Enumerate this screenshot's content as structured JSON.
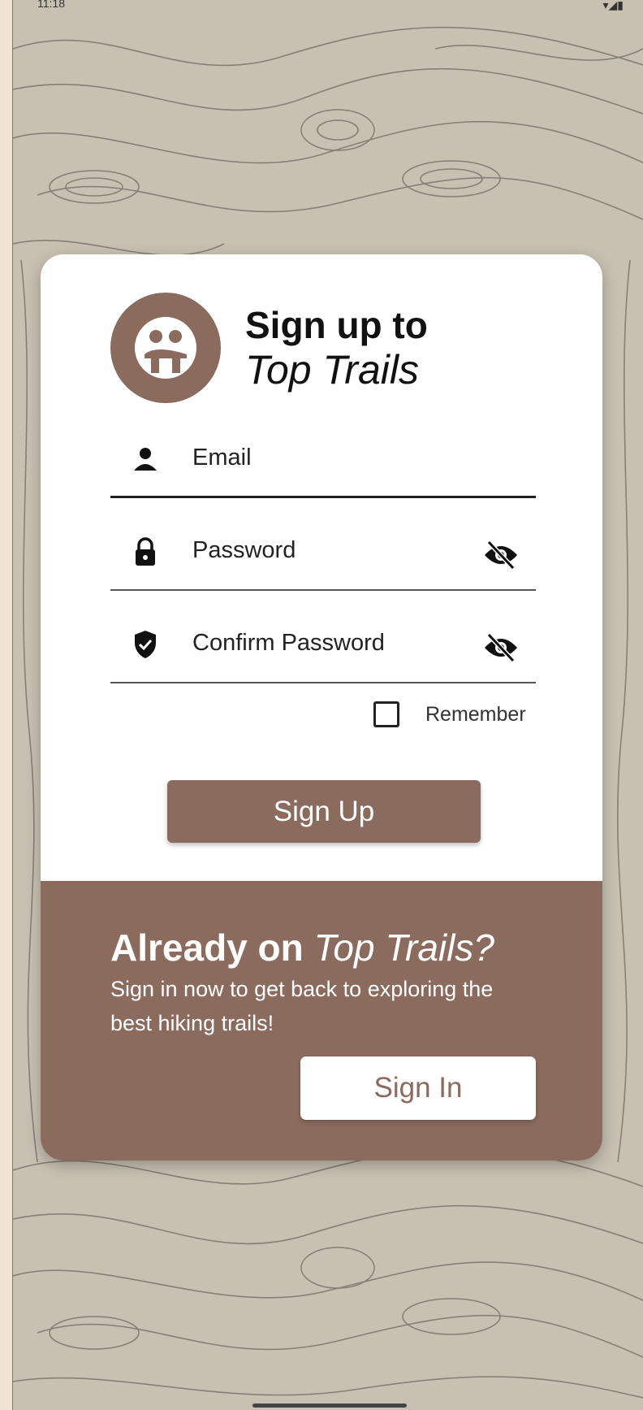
{
  "status_bar": {
    "time": "11:18"
  },
  "header": {
    "title_line1": "Sign up to",
    "title_line2": "Top Trails"
  },
  "form": {
    "email_placeholder": "Email",
    "password_placeholder": "Password",
    "confirm_placeholder": "Confirm Password",
    "remember_label": "Remember",
    "signup_label": "Sign Up"
  },
  "footer": {
    "already_bold": "Already on",
    "already_italic": "Top Trails?",
    "subtitle": "Sign in now to get back to exploring the best hiking trails!",
    "signin_label": "Sign In"
  },
  "colors": {
    "brand": "#8b6b5d",
    "map_bg": "#c8c1b2",
    "outer_bg": "#efe3d2"
  },
  "icons": [
    "hiker-logo-icon",
    "person-icon",
    "lock-icon",
    "shield-check-icon",
    "eye-off-icon"
  ]
}
